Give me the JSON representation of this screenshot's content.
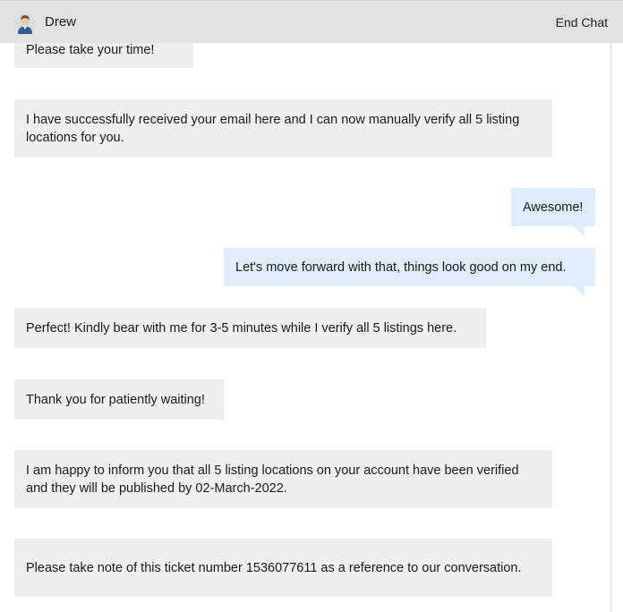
{
  "header": {
    "agent_name": "Drew",
    "end_chat_label": "End Chat"
  },
  "messages": [
    {
      "from": "agent",
      "text": "Please take your time!"
    },
    {
      "from": "agent",
      "text": "I have successfully received your email here and I can now manually verify all 5 listing locations for you."
    },
    {
      "from": "user",
      "text": "Awesome!"
    },
    {
      "from": "user",
      "text": "Let's move forward with that, things look good on my end."
    },
    {
      "from": "agent",
      "text": "Perfect! Kindly bear with me for 3-5 minutes while I verify all 5 listings here."
    },
    {
      "from": "agent",
      "text": "Thank you for patiently waiting!"
    },
    {
      "from": "agent",
      "text": "I am happy to inform you that all 5 listing locations on your account have been verified and they will be published by 02-March-2022."
    },
    {
      "from": "agent",
      "text": "Please take note of this ticket number 1536077611 as a reference to our conversation."
    }
  ],
  "colors": {
    "header_bg": "#e2e2e2",
    "agent_bubble": "#efefef",
    "user_bubble": "#deedf9"
  },
  "icons": {
    "avatar": "agent-avatar-icon"
  }
}
